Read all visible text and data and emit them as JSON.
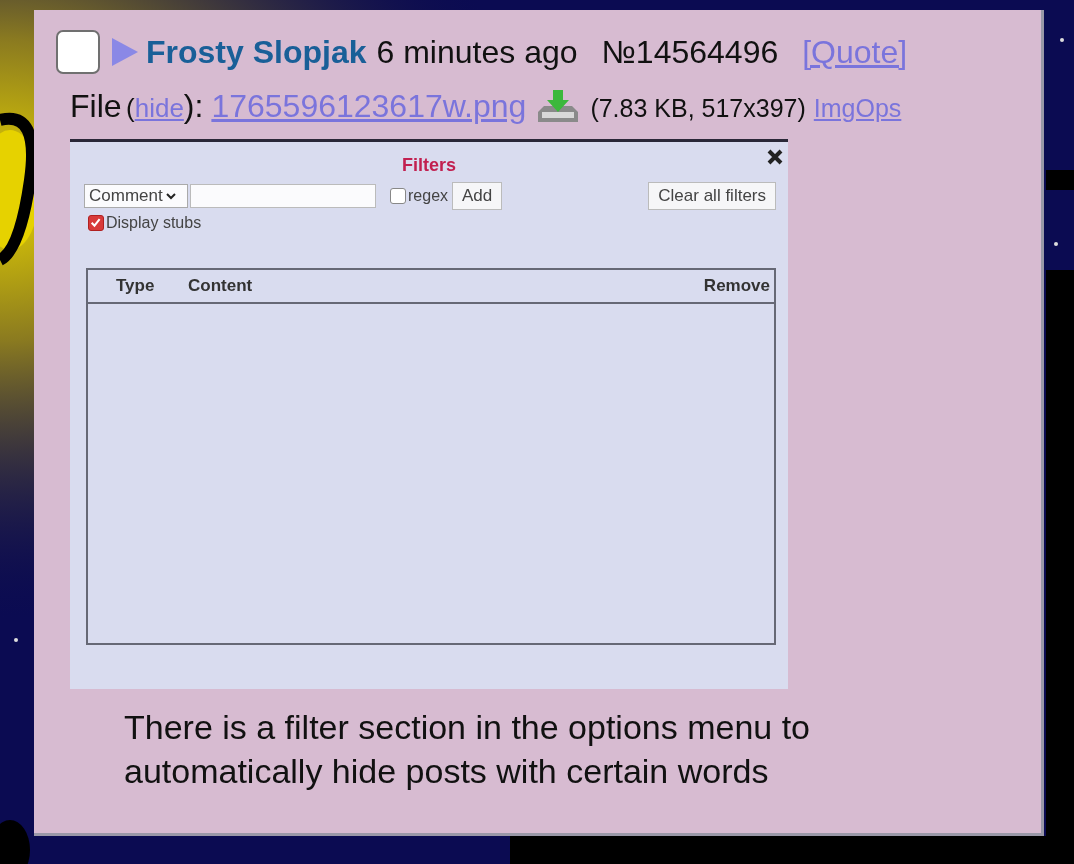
{
  "post": {
    "checked": false,
    "name": "Frosty Slopjak",
    "time": "6 minutes ago",
    "number": "№14564496",
    "quote_link": "[Quote]",
    "file": {
      "label": "File",
      "open": "(",
      "hide_link": "hide",
      "close": "):",
      "filename": "1765596123617w.png",
      "info": "(7.83 KB, 517x397)",
      "imgops": "ImgOps"
    },
    "attachment": {
      "title": "Filters",
      "type_select": "Comment",
      "regex": {
        "label": "regex",
        "checked": false
      },
      "add_button": "Add",
      "clear_button": "Clear all filters",
      "display_stubs": {
        "label": "Display stubs",
        "checked": true
      },
      "columns": [
        "Type",
        "Content",
        "Remove"
      ]
    },
    "comment": "There is a filter section in the options menu to automatically hide posts with certain words"
  }
}
